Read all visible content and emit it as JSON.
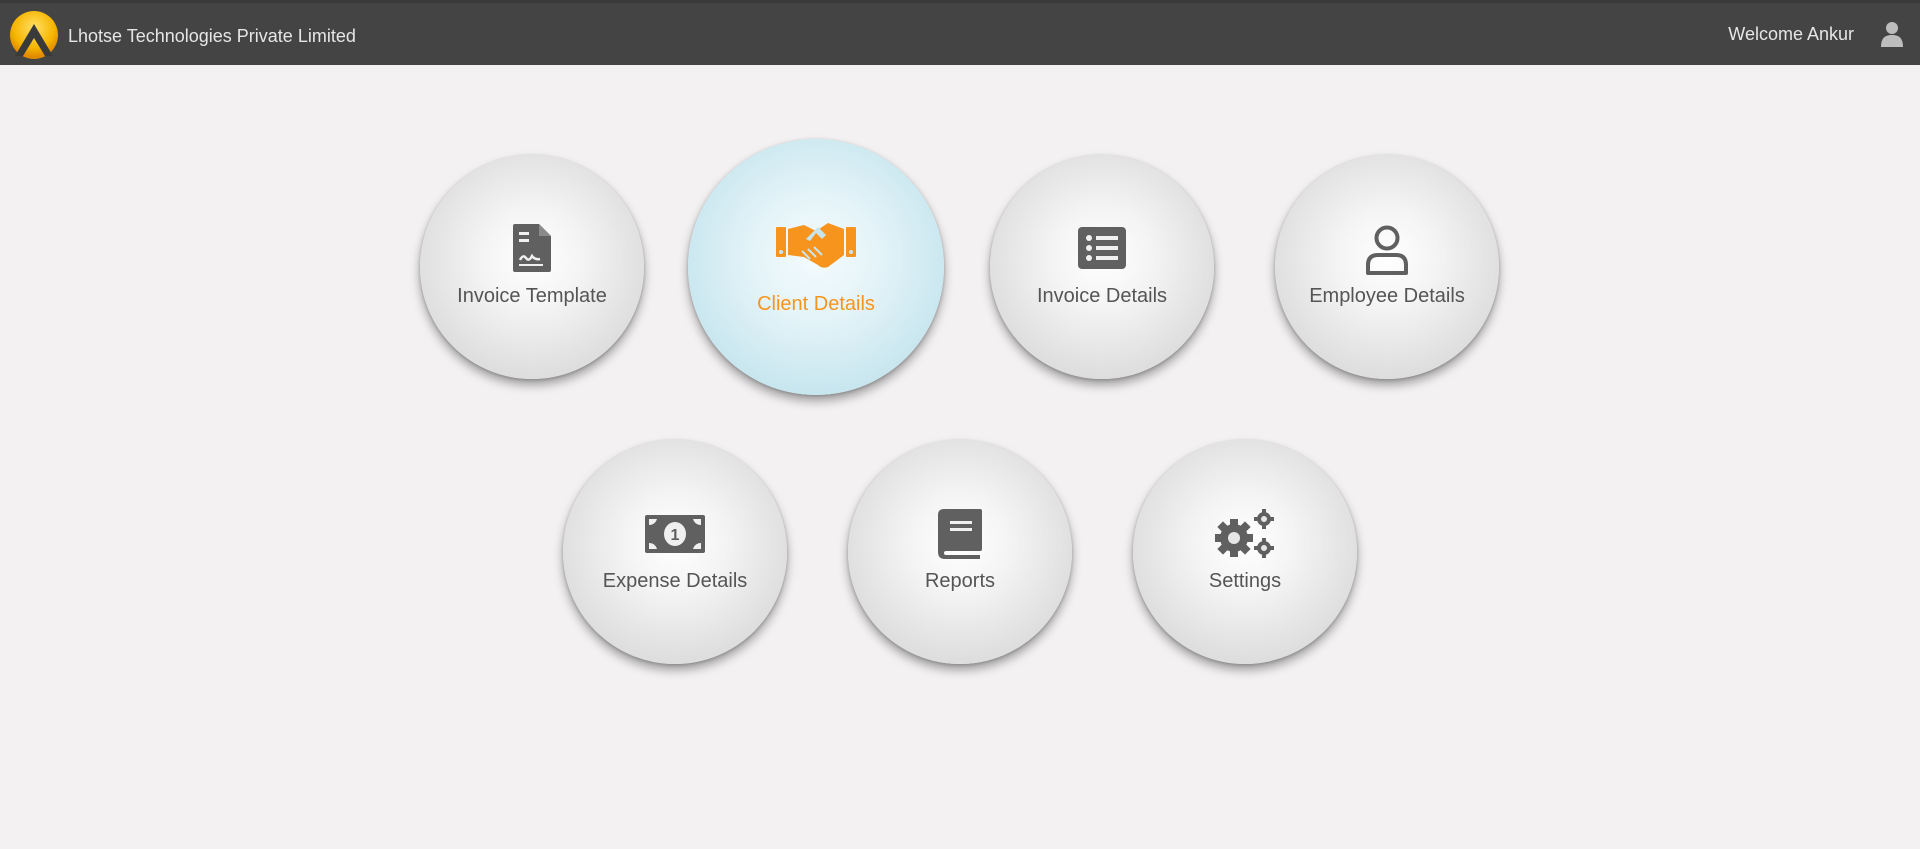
{
  "header": {
    "company_name": "Lhotse Technologies Private Limited",
    "welcome_text": "Welcome Ankur",
    "user_icon": "user-icon"
  },
  "tiles": [
    {
      "label": "Invoice Template",
      "icon": "invoice-file-icon",
      "active": false
    },
    {
      "label": "Client Details",
      "icon": "handshake-icon",
      "active": true
    },
    {
      "label": "Invoice Details",
      "icon": "list-icon",
      "active": false
    },
    {
      "label": "Employee Details",
      "icon": "person-icon",
      "active": false
    },
    {
      "label": "Expense Details",
      "icon": "money-icon",
      "active": false
    },
    {
      "label": "Reports",
      "icon": "book-icon",
      "active": false
    },
    {
      "label": "Settings",
      "icon": "gears-icon",
      "active": false
    }
  ],
  "colors": {
    "header_bg": "#444444",
    "page_bg": "#f3f1f2",
    "accent_orange": "#f7941d",
    "icon_gray": "#606060",
    "active_tile": "#c6e5ee"
  }
}
